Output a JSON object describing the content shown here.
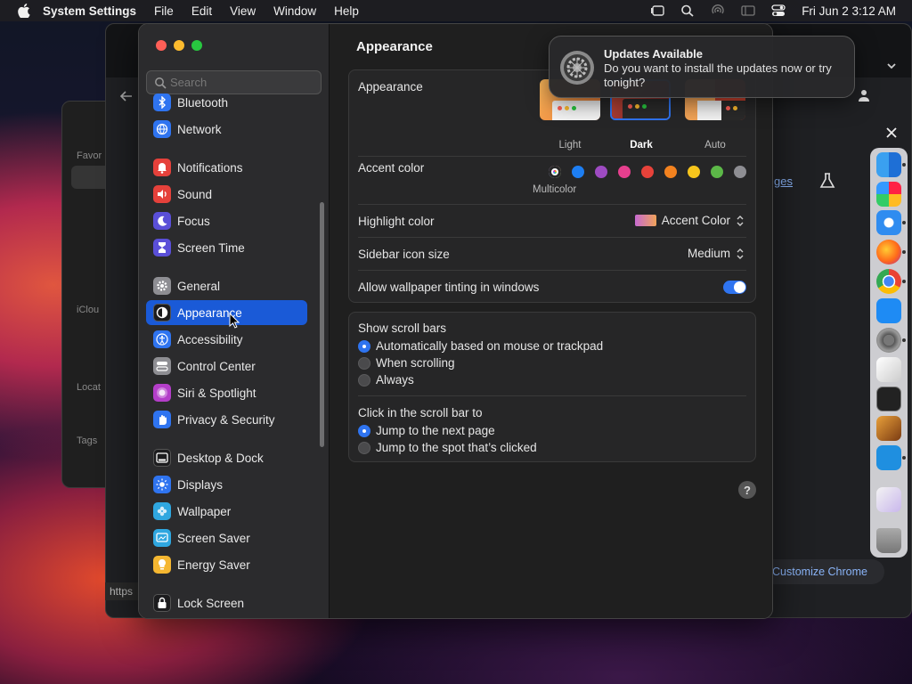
{
  "menubar": {
    "app": "System Settings",
    "items": [
      "File",
      "Edit",
      "View",
      "Window",
      "Help"
    ],
    "datetime": "Fri Jun 2  3:12 AM"
  },
  "background": {
    "https_label": "https",
    "customize_chrome": "Customize Chrome",
    "ges_label": "ges"
  },
  "sidebar": {
    "search_placeholder": "Search",
    "items": [
      {
        "label": "Bluetooth",
        "icon": "bluetooth-icon",
        "color": "#2f74f0"
      },
      {
        "label": "Network",
        "icon": "globe-icon",
        "color": "#2f74f0"
      },
      {
        "label": "Notifications",
        "icon": "bell-icon",
        "color": "#e5413b"
      },
      {
        "label": "Sound",
        "icon": "speaker-icon",
        "color": "#e5413b"
      },
      {
        "label": "Focus",
        "icon": "moon-icon",
        "color": "#5a4fd8"
      },
      {
        "label": "Screen Time",
        "icon": "hourglass-icon",
        "color": "#5a4fd8"
      },
      {
        "label": "General",
        "icon": "gear-icon",
        "color": "#8e8e93"
      },
      {
        "label": "Appearance",
        "icon": "appearance-icon",
        "color": "#1c1c1e"
      },
      {
        "label": "Accessibility",
        "icon": "accessibility-icon",
        "color": "#2f74f0"
      },
      {
        "label": "Control Center",
        "icon": "control-center-icon",
        "color": "#8e8e93"
      },
      {
        "label": "Siri & Spotlight",
        "icon": "siri-icon",
        "color": "#b43ec9"
      },
      {
        "label": "Privacy & Security",
        "icon": "hand-icon",
        "color": "#2f74f0"
      },
      {
        "label": "Desktop & Dock",
        "icon": "dock-icon",
        "color": "#1c1c1e"
      },
      {
        "label": "Displays",
        "icon": "sun-icon",
        "color": "#2f74f0"
      },
      {
        "label": "Wallpaper",
        "icon": "flower-icon",
        "color": "#2fa7e0"
      },
      {
        "label": "Screen Saver",
        "icon": "screen-saver-icon",
        "color": "#2fa7e0"
      },
      {
        "label": "Energy Saver",
        "icon": "lightbulb-icon",
        "color": "#f5b731"
      },
      {
        "label": "Lock Screen",
        "icon": "lock-icon",
        "color": "#1c1c1e"
      }
    ]
  },
  "content": {
    "title": "Appearance",
    "appearance": {
      "label": "Appearance",
      "options": [
        "Light",
        "Dark",
        "Auto"
      ],
      "selected": "Dark"
    },
    "accent": {
      "label": "Accent color",
      "caption": "Multicolor",
      "colors": [
        "multicolor",
        "#1d7ef2",
        "#9e4bc2",
        "#e63f8e",
        "#e7423a",
        "#f3821f",
        "#f6c51c",
        "#5cb848",
        "#8e8e93"
      ]
    },
    "highlight": {
      "label": "Highlight color",
      "value": "Accent Color"
    },
    "sidebar_icon": {
      "label": "Sidebar icon size",
      "value": "Medium"
    },
    "tinting": {
      "label": "Allow wallpaper tinting in windows",
      "on": true
    },
    "scrollbars": {
      "label": "Show scroll bars",
      "options": [
        "Automatically based on mouse or trackpad",
        "When scrolling",
        "Always"
      ],
      "selected": 0
    },
    "click": {
      "label": "Click in the scroll bar to",
      "options": [
        "Jump to the next page",
        "Jump to the spot that’s clicked"
      ],
      "selected": 0
    },
    "help": "?"
  },
  "notification": {
    "title": "Updates Available",
    "body": "Do you want to install the updates now or try tonight?"
  }
}
